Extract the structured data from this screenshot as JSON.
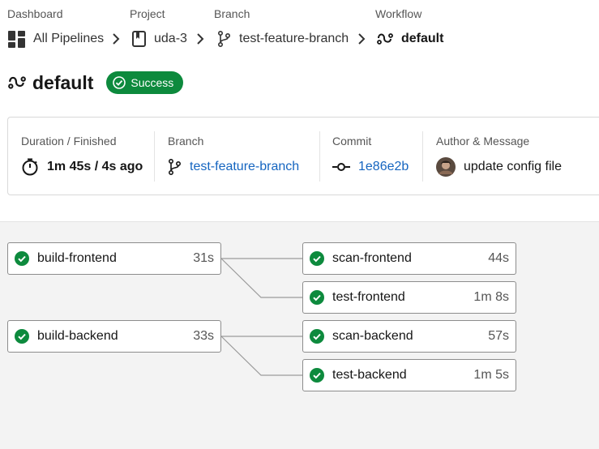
{
  "breadcrumb": {
    "dashboard": {
      "label": "Dashboard",
      "value": "All Pipelines"
    },
    "project": {
      "label": "Project",
      "value": "uda-3"
    },
    "branch": {
      "label": "Branch",
      "value": "test-feature-branch"
    },
    "workflow": {
      "label": "Workflow",
      "value": "default"
    }
  },
  "title": {
    "text": "default",
    "status": "Success"
  },
  "info": {
    "duration": {
      "label": "Duration / Finished",
      "value": "1m 45s / 4s ago"
    },
    "branch": {
      "label": "Branch",
      "value": "test-feature-branch"
    },
    "commit": {
      "label": "Commit",
      "value": "1e86e2b"
    },
    "author": {
      "label": "Author & Message",
      "value": "update config file"
    }
  },
  "jobs": [
    {
      "name": "build-frontend",
      "duration": "31s"
    },
    {
      "name": "scan-frontend",
      "duration": "44s"
    },
    {
      "name": "test-frontend",
      "duration": "1m 8s"
    },
    {
      "name": "build-backend",
      "duration": "33s"
    },
    {
      "name": "scan-backend",
      "duration": "57s"
    },
    {
      "name": "test-backend",
      "duration": "1m 5s"
    }
  ],
  "colors": {
    "success": "#0d8a3d",
    "link": "#1565c0",
    "canvas": "#f3f3f3"
  },
  "icons": [
    "dashboard-icon",
    "project-icon",
    "branch-icon",
    "workflow-icon",
    "timer-icon",
    "commit-icon",
    "check-circle-icon",
    "chevron-right-icon"
  ]
}
